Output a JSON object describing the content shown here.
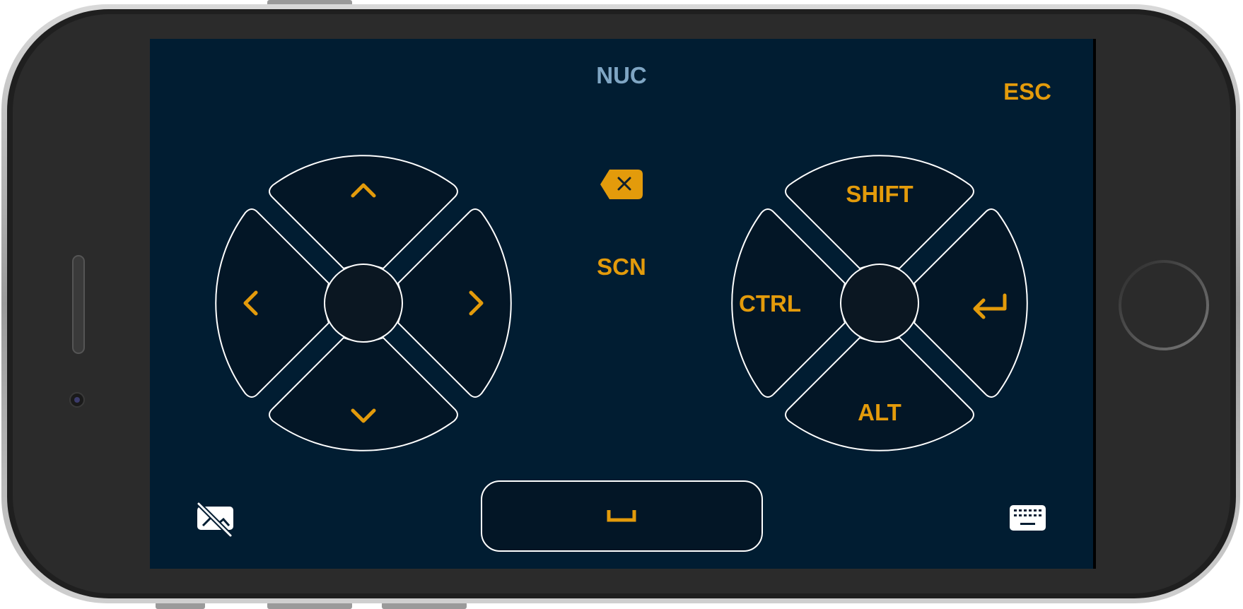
{
  "device": {
    "frame_color": "#2b2b2b",
    "bezel_edge_color": "#bdbdbd",
    "screen_color": "#011d32"
  },
  "header": {
    "host_label": "NUC",
    "host_color": "#7fa6c4",
    "escape_label": "ESC"
  },
  "accent_color": "#e39b0b",
  "dpad": {
    "up_icon": "chevron-up-icon",
    "down_icon": "chevron-down-icon",
    "left_icon": "chevron-left-icon",
    "right_icon": "chevron-right-icon"
  },
  "center_controls": {
    "backspace_icon": "backspace-icon",
    "screen_label": "SCN"
  },
  "modifier_pad": {
    "top_label": "SHIFT",
    "left_label": "CTRL",
    "bottom_label": "ALT",
    "right_icon": "enter-icon"
  },
  "bottom_bar": {
    "left_icon": "no-video-icon",
    "space_icon": "space-bar-icon",
    "right_icon": "keyboard-icon"
  }
}
